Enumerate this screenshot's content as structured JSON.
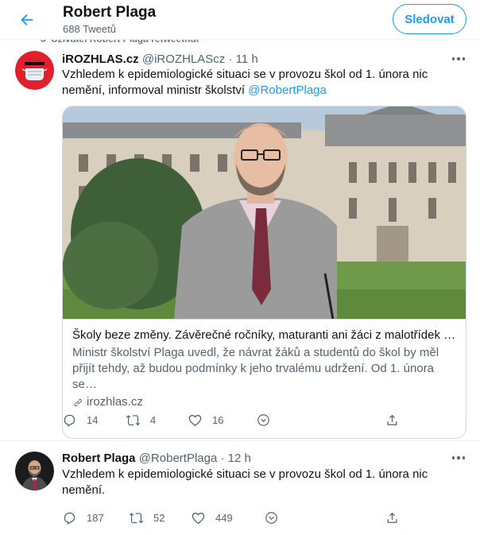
{
  "header": {
    "title": "Robert Plaga",
    "subtitle": "688 Tweetů",
    "follow_label": "Sledovat"
  },
  "retweet_note": "Uživatel Robert Plaga retweetnul",
  "tweets": [
    {
      "author": "iROZHLAS.cz",
      "handle": "@iROZHLAScz",
      "dot": "·",
      "time": "11 h",
      "text": "Vzhledem k epidemiologické situaci se v provozu škol od 1. února nic nemění, informoval ministr školství",
      "mention": "@RobertPlaga",
      "card": {
        "title": "Školy beze změny. Závěrečné ročníky, maturanti ani žáci z malotřídek se…",
        "description": "Ministr školství Plaga uvedl, že návrat žáků a studentů do škol by měl přijít tehdy, až budou podmínky k jeho trvalému udržení. Od 1. února se…",
        "domain": "irozhlas.cz"
      },
      "stats": {
        "replies": "14",
        "retweets": "4",
        "likes": "16"
      }
    },
    {
      "author": "Robert Plaga",
      "handle": "@RobertPlaga",
      "dot": "·",
      "time": "12 h",
      "text": "Vzhledem k epidemiologické situaci se v provozu škol od 1. února nic nemění.",
      "stats": {
        "replies": "187",
        "retweets": "52",
        "likes": "449"
      }
    }
  ],
  "icons": {
    "back": "arrow-left-icon",
    "more": "more-icon",
    "reply": "reply-icon",
    "retweet": "retweet-icon",
    "like": "heart-icon",
    "save": "bookmark-icon",
    "share": "share-icon",
    "link": "link-icon"
  },
  "colors": {
    "accent": "#1d9bf0",
    "text": "#0f1419",
    "muted": "#536471",
    "border": "#cfd9de"
  }
}
